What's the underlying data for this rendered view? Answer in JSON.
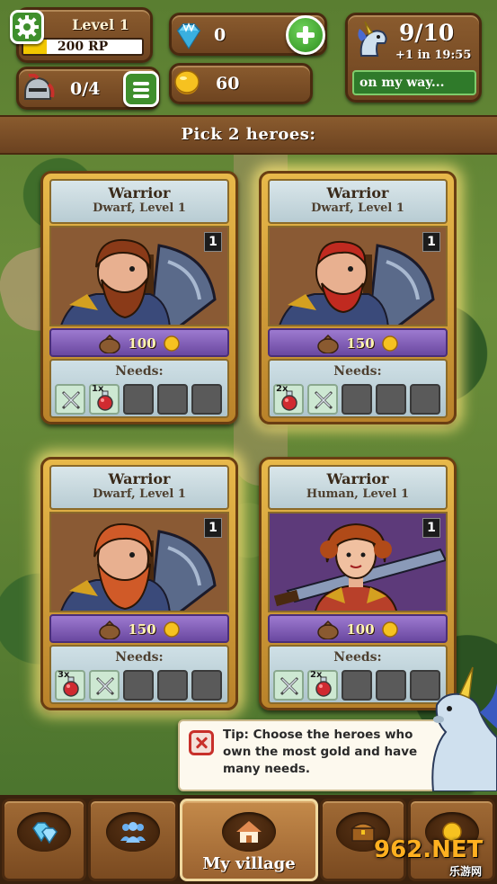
{
  "hud": {
    "level_label": "Level 1",
    "rp_text": "200 RP",
    "rp_progress": 0.2,
    "gems": "0",
    "heroes": "0/4",
    "gold": "60",
    "unicorn_count": "9/10",
    "unicorn_timer": "+1 in 19:55",
    "unicorn_status": "on my way..."
  },
  "banner": {
    "text": "Pick 2 heroes:"
  },
  "cards": [
    {
      "title": "Warrior",
      "subtitle": "Dwarf, Level 1",
      "level": "1",
      "price": "100",
      "needs_label": "Needs:",
      "slots": [
        {
          "icon": "sword-icon",
          "qty": ""
        },
        {
          "icon": "potion-icon",
          "qty": "1x"
        },
        {
          "icon": "",
          "qty": ""
        },
        {
          "icon": "",
          "qty": ""
        },
        {
          "icon": "",
          "qty": ""
        }
      ]
    },
    {
      "title": "Warrior",
      "subtitle": "Dwarf, Level 1",
      "level": "1",
      "price": "150",
      "needs_label": "Needs:",
      "slots": [
        {
          "icon": "potion-icon",
          "qty": "2x"
        },
        {
          "icon": "sword-icon",
          "qty": ""
        },
        {
          "icon": "",
          "qty": ""
        },
        {
          "icon": "",
          "qty": ""
        },
        {
          "icon": "",
          "qty": ""
        }
      ]
    },
    {
      "title": "Warrior",
      "subtitle": "Dwarf, Level 1",
      "level": "1",
      "price": "150",
      "needs_label": "Needs:",
      "slots": [
        {
          "icon": "potion-icon",
          "qty": "3x"
        },
        {
          "icon": "sword-icon",
          "qty": ""
        },
        {
          "icon": "",
          "qty": ""
        },
        {
          "icon": "",
          "qty": ""
        },
        {
          "icon": "",
          "qty": ""
        }
      ]
    },
    {
      "title": "Warrior",
      "subtitle": "Human, Level 1",
      "level": "1",
      "price": "100",
      "needs_label": "Needs:",
      "slots": [
        {
          "icon": "sword-icon",
          "qty": ""
        },
        {
          "icon": "potion-icon",
          "qty": "2x"
        },
        {
          "icon": "",
          "qty": ""
        },
        {
          "icon": "",
          "qty": ""
        },
        {
          "icon": "",
          "qty": ""
        }
      ]
    }
  ],
  "tip": {
    "text": "Tip: Choose the heroes who own the most gold and have many needs."
  },
  "nav": {
    "village_label": "My village"
  },
  "watermark": {
    "main": "962.NET",
    "sub": "乐游网"
  },
  "colors": {
    "card_gold": "#e8b94a",
    "price_purple": "#8a66c0",
    "needs_blue": "#c0d4dc",
    "wood": "#7a4a20"
  }
}
